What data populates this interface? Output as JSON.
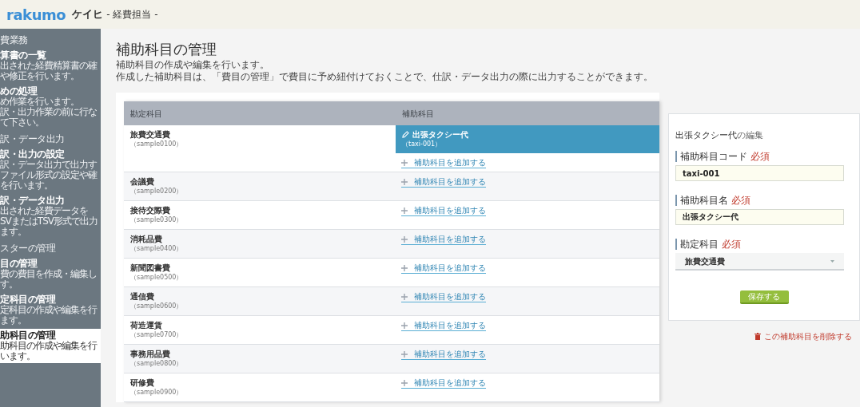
{
  "header": {
    "logo": "rakumo",
    "app_name": "ケイヒ",
    "role": "- 経費担当 -"
  },
  "sidebar": {
    "sections": [
      {
        "title": "費業務",
        "items": [
          {
            "title": "算書の一覧",
            "lines": [
              "出された経費精算書の確",
              "や修正を行います。"
            ],
            "selected": false
          },
          {
            "title": "めの処理",
            "lines": [
              "め作業を行います。",
              "訳・出力作業の前に行な",
              "て下さい。"
            ],
            "selected": false
          }
        ]
      },
      {
        "title": "訳・データ出力",
        "items": [
          {
            "title": "訳・出力の設定",
            "lines": [
              "訳・データ出力で出力す",
              "ファイル形式の設定や確",
              "を行います。"
            ],
            "selected": false
          },
          {
            "title": "訳・データ出力",
            "lines": [
              "出された経費データを",
              "SVまたはTSV形式で出力",
              "ます。"
            ],
            "selected": false
          }
        ]
      },
      {
        "title": "スターの管理",
        "items": [
          {
            "title": "目の管理",
            "lines": [
              "費の費目を作成・編集し",
              "す。"
            ],
            "selected": false
          },
          {
            "title": "定科目の管理",
            "lines": [
              "定科目の作成や編集を行",
              "ます。"
            ],
            "selected": false
          },
          {
            "title": "助科目の管理",
            "lines": [
              "助科目の作成や編集を行",
              "います。"
            ],
            "selected": true
          }
        ]
      }
    ]
  },
  "page": {
    "title": "補助科目の管理",
    "description": [
      "補助科目の作成や編集を行います。",
      "作成した補助科目は、「費目の管理」で費目に予め紐付けておくことで、仕訳・データ出力の際に出力することができます。"
    ]
  },
  "table": {
    "columns": [
      "勘定科目",
      "補助科目"
    ],
    "rows": [
      {
        "name": "旅費交通費",
        "code": "（sample0100）",
        "subitems": [
          {
            "name": "出張タクシー代",
            "code": "（taxi-001）",
            "selected": true
          }
        ],
        "add_link": "補助科目を追加する"
      },
      {
        "name": "会議費",
        "code": "（sample0200）",
        "subitems": [],
        "add_link": "補助科目を追加する"
      },
      {
        "name": "接待交際費",
        "code": "（sample0300）",
        "subitems": [],
        "add_link": "補助科目を追加する"
      },
      {
        "name": "消耗品費",
        "code": "（sample0400）",
        "subitems": [],
        "add_link": "補助科目を追加する"
      },
      {
        "name": "新聞図書費",
        "code": "（sample0500）",
        "subitems": [],
        "add_link": "補助科目を追加する"
      },
      {
        "name": "通信費",
        "code": "（sample0600）",
        "subitems": [],
        "add_link": "補助科目を追加する"
      },
      {
        "name": "荷造運賃",
        "code": "（sample0700）",
        "subitems": [],
        "add_link": "補助科目を追加する"
      },
      {
        "name": "事務用品費",
        "code": "（sample0800）",
        "subitems": [],
        "add_link": "補助科目を追加する"
      },
      {
        "name": "研修費",
        "code": "（sample0900）",
        "subitems": [],
        "add_link": "補助科目を追加する"
      }
    ]
  },
  "edit_panel": {
    "title_name": "出張タクシー代",
    "title_suffix": "の編集",
    "fields": [
      {
        "kind": "text",
        "label": "補助科目コード",
        "required": "必須",
        "value": "taxi-001"
      },
      {
        "kind": "text",
        "label": "補助科目名",
        "required": "必須",
        "value": "出張タクシー代"
      },
      {
        "kind": "select",
        "label": "勘定科目",
        "required": "必須",
        "value": "旅費交通費"
      }
    ],
    "save_button": "保存する",
    "delete_link": "この補助科目を削除する"
  }
}
